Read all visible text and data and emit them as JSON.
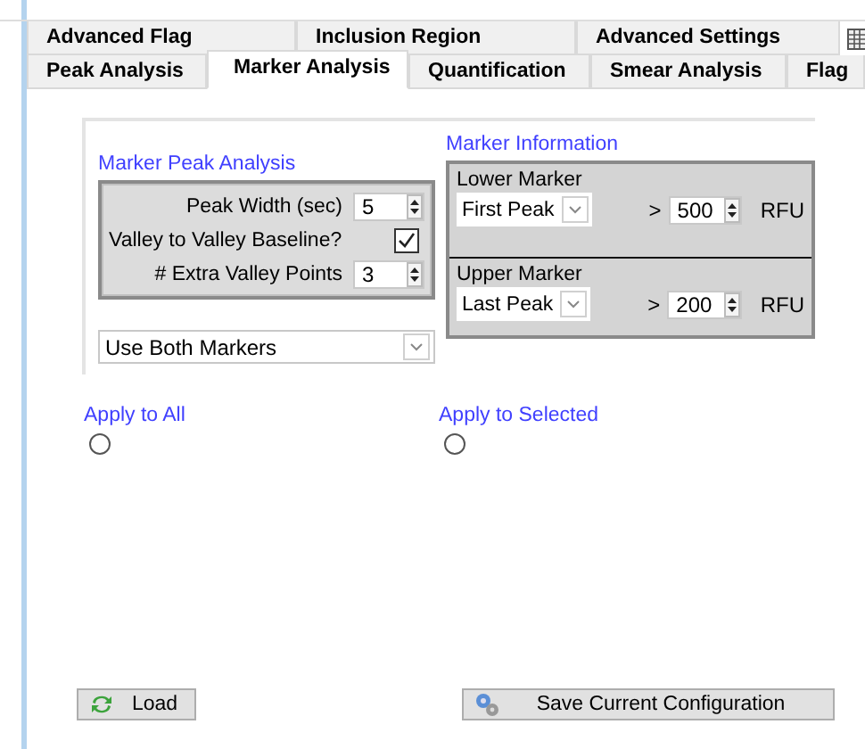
{
  "tab_rows": [
    {
      "tabs": [
        {
          "label": "Advanced Flag",
          "selected": false
        },
        {
          "label": "Inclusion Region",
          "selected": false
        },
        {
          "label": "Advanced Settings",
          "selected": false
        }
      ]
    },
    {
      "tabs": [
        {
          "label": "Peak Analysis",
          "selected": false
        },
        {
          "label": "Marker Analysis",
          "selected": true
        },
        {
          "label": "Quantification",
          "selected": false
        },
        {
          "label": "Smear Analysis",
          "selected": false
        },
        {
          "label": "Flag",
          "selected": false
        }
      ]
    }
  ],
  "marker_peak_analysis": {
    "title": "Marker Peak Analysis",
    "fields": [
      {
        "kind": "spinner",
        "label": "Peak Width (sec)",
        "value": "5"
      },
      {
        "kind": "checkbox",
        "label": "Valley to Valley Baseline?",
        "checked": true
      },
      {
        "kind": "spinner",
        "label": "# Extra Valley Points",
        "value": "3"
      }
    ]
  },
  "marker_mode": {
    "value": "Use Both Markers"
  },
  "marker_information": {
    "title": "Marker Information",
    "markers": [
      {
        "label": "Lower Marker",
        "peak": "First Peak",
        "operator": ">",
        "threshold": "500",
        "unit": "RFU"
      },
      {
        "label": "Upper Marker",
        "peak": "Last Peak",
        "operator": ">",
        "threshold": "200",
        "unit": "RFU"
      }
    ]
  },
  "apply_options": [
    {
      "label": "Apply to All",
      "selected": false
    },
    {
      "label": "Apply to Selected",
      "selected": false
    }
  ],
  "buttons": [
    {
      "kind": "load",
      "label": "Load"
    },
    {
      "kind": "save",
      "label": "Save Current Configuration"
    }
  ]
}
